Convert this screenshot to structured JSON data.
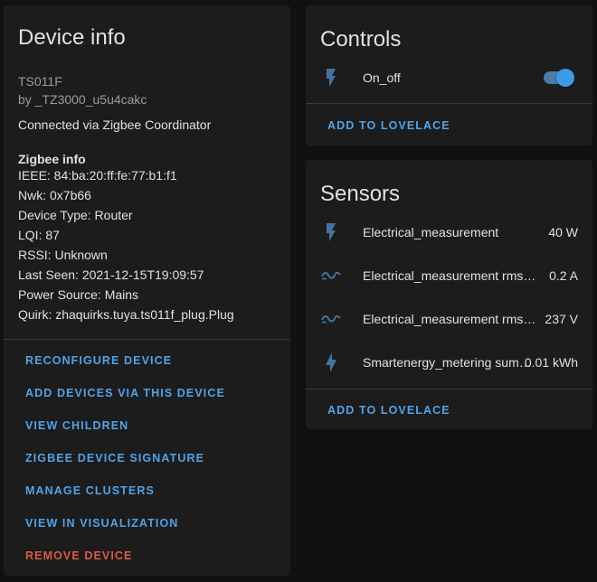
{
  "device_info": {
    "title": "Device info",
    "model": "TS011F",
    "manufacturer": "by _TZ3000_u5u4cakc",
    "connection": "Connected via Zigbee Coordinator",
    "zigbee_heading": "Zigbee info",
    "zigbee_lines": [
      "IEEE: 84:ba:20:ff:fe:77:b1:f1",
      "Nwk: 0x7b66",
      "Device Type: Router",
      "LQI: 87",
      "RSSI: Unknown",
      "Last Seen: 2021-12-15T19:09:57",
      "Power Source: Mains",
      "Quirk: zhaquirks.tuya.ts011f_plug.Plug"
    ],
    "actions": [
      "RECONFIGURE DEVICE",
      "ADD DEVICES VIA THIS DEVICE",
      "VIEW CHILDREN",
      "ZIGBEE DEVICE SIGNATURE",
      "MANAGE CLUSTERS",
      "VIEW IN VISUALIZATION",
      "REMOVE DEVICE"
    ]
  },
  "controls": {
    "title": "Controls",
    "entities": [
      {
        "name": "On_off",
        "icon": "flash-icon",
        "state": "on"
      }
    ],
    "add_to_lovelace": "ADD TO LOVELACE"
  },
  "sensors": {
    "title": "Sensors",
    "entities": [
      {
        "name": "Electrical_measurement",
        "value": "40 W",
        "icon": "flash-icon"
      },
      {
        "name": "Electrical_measurement rms_current",
        "value": "0.2 A",
        "icon": "current-ac-icon"
      },
      {
        "name": "Electrical_measurement rms_voltage",
        "value": "237 V",
        "icon": "sine-wave-icon"
      },
      {
        "name": "Smartenergy_metering summation_delivered",
        "value": "0.01 kWh",
        "icon": "lightning-bolt-icon"
      }
    ],
    "add_to_lovelace": "ADD TO LOVELACE"
  },
  "colors": {
    "background": "#111111",
    "card": "#1c1c1c",
    "primary_text": "#e1e1e1",
    "secondary_text": "#9b9b9b",
    "accent": "#4fa3e8",
    "danger": "#db5b44",
    "icon": "#44739e",
    "toggle_on": "#3d9ae6"
  }
}
